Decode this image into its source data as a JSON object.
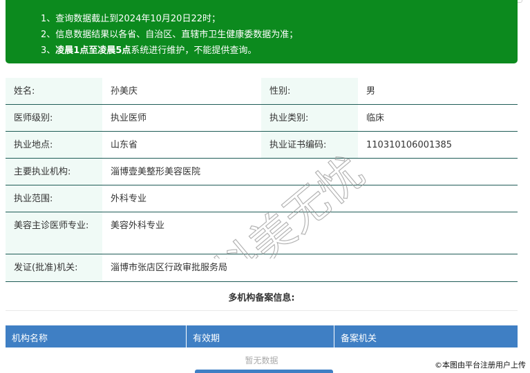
{
  "notice": {
    "line1": "1、查询数据截止到2024年10月20日22时；",
    "line2": "2、信息数据结果以各省、自治区、直辖市卫生健康委数据为准；",
    "line3_prefix": "3、",
    "line3_bold": "凌晨1点至凌晨5点",
    "line3_suffix": "系统进行维护，不能提供查询。"
  },
  "info": {
    "name_label": "姓名:",
    "name_value": "孙美庆",
    "gender_label": "性别:",
    "gender_value": "男",
    "level_label": "医师级别:",
    "level_value": "执业医师",
    "category_label": "执业类别:",
    "category_value": "临床",
    "location_label": "执业地点:",
    "location_value": "山东省",
    "cert_label": "执业证书编码:",
    "cert_value": "110310106001385",
    "institution_label": "主要执业机构:",
    "institution_value": "淄博壹美整形美容医院",
    "scope_label": "执业范围:",
    "scope_value": "外科专业",
    "cosmetic_label": "美容主诊医师专业:",
    "cosmetic_value": "美容外科专业",
    "issuer_label": "发证(批准)机关:",
    "issuer_value": "淄博市张店区行政审批服务局"
  },
  "multi": {
    "title": "多机构备案信息:",
    "columns": [
      "机构名称",
      "有效期",
      "备案机关"
    ],
    "empty_text": "暂无数据"
  },
  "watermark": "抖美无忧",
  "copyright": "©本图由平台注册用户上传",
  "colors": {
    "notice_bg": "#0c8a1e",
    "header_bg": "#3f7fc4",
    "label_bg": "#f0faf6",
    "row_border": "#1d5a55"
  }
}
